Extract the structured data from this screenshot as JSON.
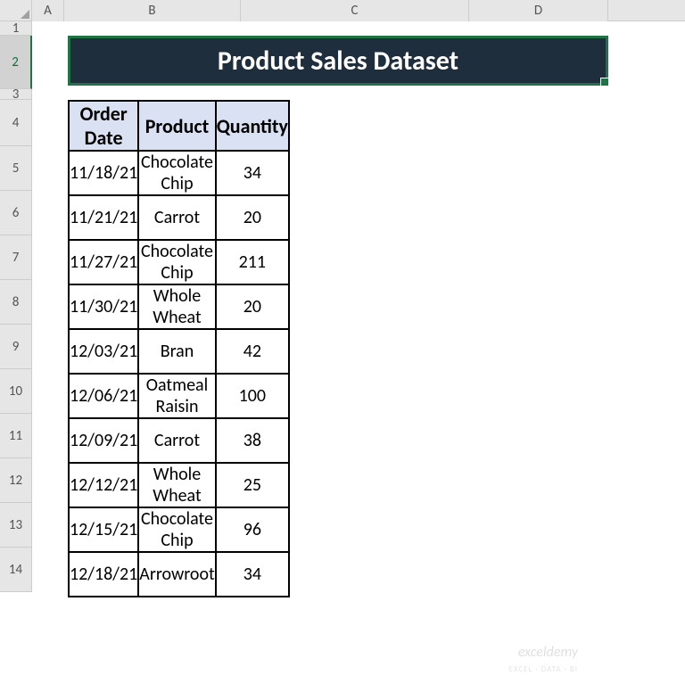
{
  "columns": {
    "A": "A",
    "B": "B",
    "C": "C",
    "D": "D"
  },
  "rows": {
    "r1": "1",
    "r2": "2",
    "r3": "3",
    "r4": "4",
    "r5": "5",
    "r6": "6",
    "r7": "7",
    "r8": "8",
    "r9": "9",
    "r10": "10",
    "r11": "11",
    "r12": "12",
    "r13": "13",
    "r14": "14"
  },
  "title": "Product Sales Dataset",
  "headers": {
    "order_date": "Order Date",
    "product": "Product",
    "quantity": "Quantity"
  },
  "data": [
    {
      "date": "11/18/21",
      "product": "Chocolate Chip",
      "qty": "34"
    },
    {
      "date": "11/21/21",
      "product": "Carrot",
      "qty": "20"
    },
    {
      "date": "11/27/21",
      "product": "Chocolate Chip",
      "qty": "211"
    },
    {
      "date": "11/30/21",
      "product": "Whole Wheat",
      "qty": "20"
    },
    {
      "date": "12/03/21",
      "product": "Bran",
      "qty": "42"
    },
    {
      "date": "12/06/21",
      "product": "Oatmeal Raisin",
      "qty": "100"
    },
    {
      "date": "12/09/21",
      "product": "Carrot",
      "qty": "38"
    },
    {
      "date": "12/12/21",
      "product": "Whole Wheat",
      "qty": "25"
    },
    {
      "date": "12/15/21",
      "product": "Chocolate Chip",
      "qty": "96"
    },
    {
      "date": "12/18/21",
      "product": "Arrowroot",
      "qty": "34"
    }
  ],
  "watermark": {
    "main": "exceldemy",
    "sub": "EXCEL · DATA · BI"
  }
}
